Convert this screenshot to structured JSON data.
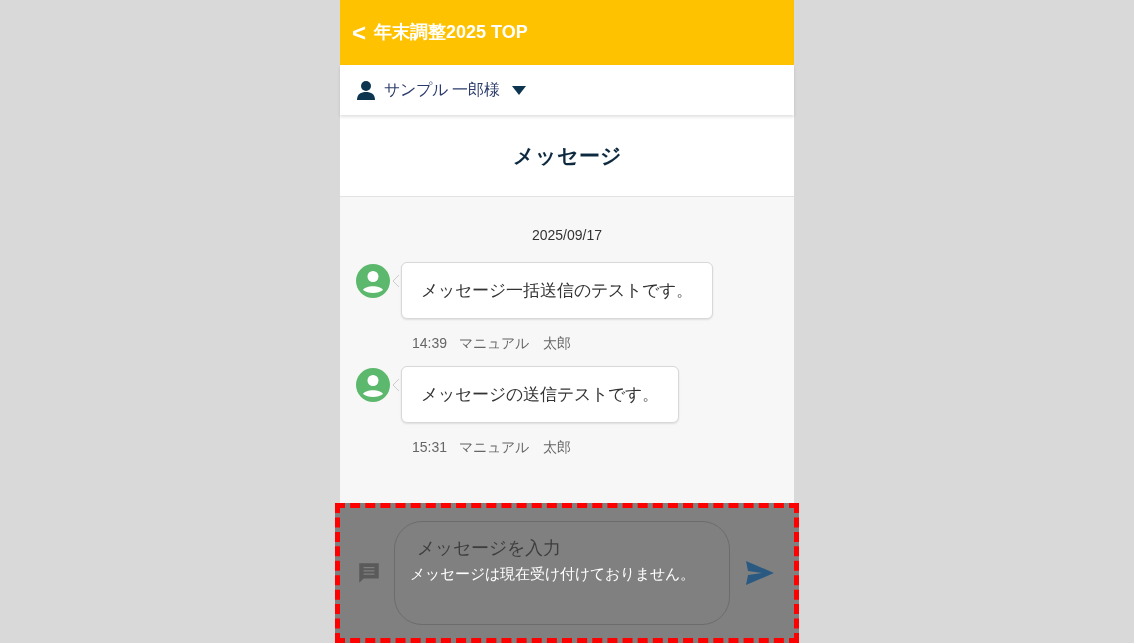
{
  "header": {
    "back_label": "<",
    "title": "年末調整2025 TOP"
  },
  "user": {
    "name": "サンプル 一郎様"
  },
  "page_title": "メッセージ",
  "date": "2025/09/17",
  "messages": [
    {
      "text": "メッセージ一括送信のテストです。",
      "time": "14:39",
      "sender": "マニュアル　太郎"
    },
    {
      "text": "メッセージの送信テストです。",
      "time": "15:31",
      "sender": "マニュアル　太郎"
    }
  ],
  "composer": {
    "placeholder": "メッセージを入力",
    "disabled": true,
    "notice": "メッセージは現在受け付けておりません。"
  }
}
